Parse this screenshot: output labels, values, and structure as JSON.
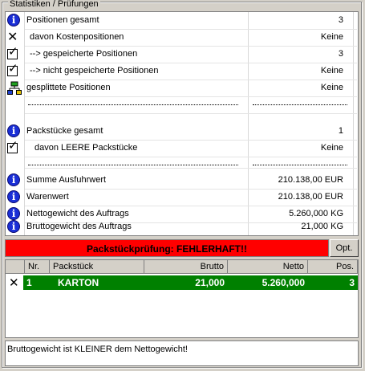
{
  "group_title": "Statistiken / Prüfungen",
  "stats_rows": [
    {
      "icon": "info-icon",
      "label": "Positionen gesamt",
      "value": "3"
    },
    {
      "icon": "x-icon",
      "label": "davon Kostenpositionen",
      "value": "Keine"
    },
    {
      "icon": "check-icon",
      "label": "--> gespeicherte Positionen",
      "value": "3"
    },
    {
      "icon": "check-icon",
      "label": "--> nicht gespeicherte Positionen",
      "value": "Keine"
    },
    {
      "icon": "split-icon",
      "label": "gesplittete Positionen",
      "value": "Keine"
    },
    {
      "icon": "info-icon",
      "label": "Packstücke gesamt",
      "value": "1"
    },
    {
      "icon": "check-icon",
      "label": "davon LEERE Packstücke",
      "value": "Keine"
    },
    {
      "icon": "info-icon",
      "label": "Summe Ausfuhrwert",
      "value": "210.138,00 EUR"
    },
    {
      "icon": "info-icon",
      "label": "Warenwert",
      "value": "210.138,00 EUR"
    },
    {
      "icon": "info-icon",
      "label": "Nettogewicht des Auftrags",
      "value": "5.260,000 KG"
    },
    {
      "icon": "info-icon",
      "label": "Bruttogewicht des Auftrags",
      "value": "21,000 KG"
    }
  ],
  "status": {
    "text": "Packstückprüfung: FEHLERHAFT!!",
    "color": "#ff0000"
  },
  "opt_button": "Opt.",
  "grid": {
    "headers": [
      "Nr.",
      "Packstück",
      "Brutto",
      "Netto",
      "Pos."
    ],
    "rows": [
      {
        "nr": "1",
        "packstueck": "KARTON",
        "brutto": "21,000",
        "netto": "5.260,000",
        "pos": "3"
      }
    ],
    "row_color": "#008000"
  },
  "message": "Bruttogewicht ist KLEINER dem Nettogewicht!"
}
